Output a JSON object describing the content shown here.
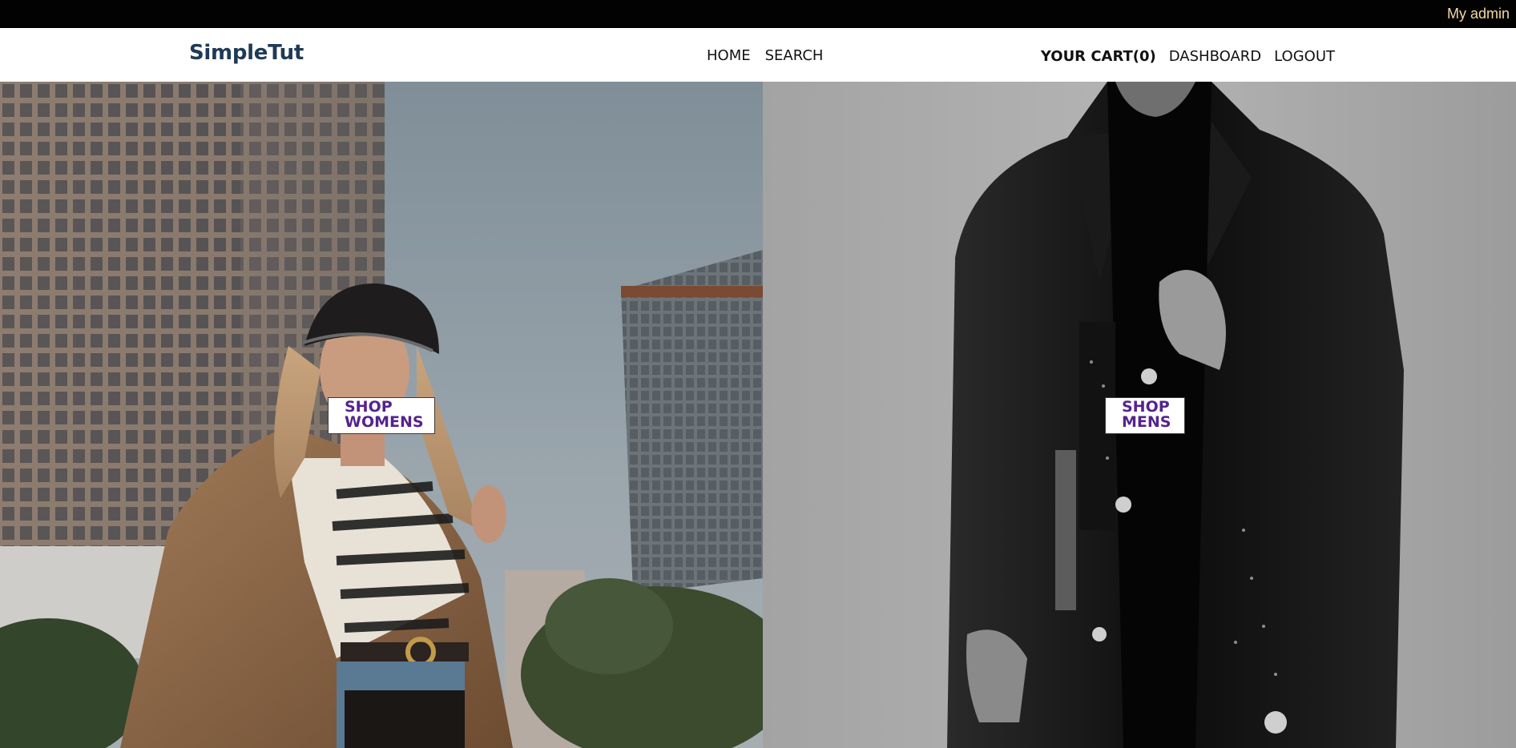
{
  "topbar": {
    "my_admin_label": "My admin"
  },
  "header": {
    "logo": "SimpleTut",
    "nav_center": [
      {
        "label": "HOME"
      },
      {
        "label": "SEARCH"
      }
    ],
    "nav_right": {
      "cart_label": "YOUR CART(0)",
      "dashboard_label": "DASHBOARD",
      "logout_label": "LOGOUT"
    }
  },
  "hero": {
    "women": {
      "button_line1": "SHOP",
      "button_line2": "WOMENS"
    },
    "men": {
      "button_line1": "SHOP",
      "button_line2": "MENS"
    }
  },
  "colors": {
    "topbar_bg": "#020202",
    "admin_link": "#f3d7a5",
    "logo": "#1f3a56",
    "button_text": "#55238d"
  }
}
